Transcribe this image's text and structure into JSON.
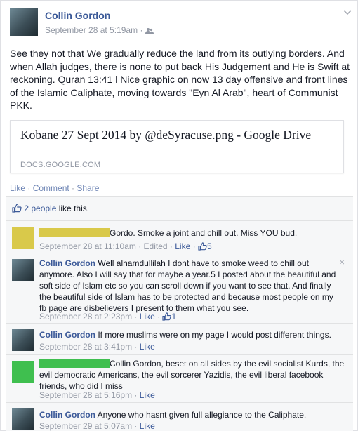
{
  "post": {
    "author": "Collin Gordon",
    "timestamp": "September 28 at 5:19am",
    "audience_icon": "friends-icon",
    "text": "See they not that We gradually reduce the land from its outlying borders. And when Allah judges, there is none to put back His Judgement and He is Swift at reckoning. Quran 13:41 l Nice graphic on now 13 day offensive and front lines of the Islamic Caliphate, moving towards \"Eyn Al Arab\", heart of Communist PKK.",
    "link": {
      "title": "Kobane 27 Sept 2014 by @deSyracuse.png - Google Drive",
      "domain": "DOCS.GOOGLE.COM"
    },
    "actions": {
      "like": "Like",
      "comment": "Comment",
      "share": "Share",
      "sep": " · "
    }
  },
  "likes": {
    "people": "2 people",
    "suffix": " like this."
  },
  "comments": [
    {
      "author_redacted": true,
      "text": "Gordo. Smoke a joint and chill out. Miss YOU bud.",
      "timestamp": "September 28 at 11:10am",
      "edited": "Edited",
      "like_label": "Like",
      "like_count": "5"
    },
    {
      "author": "Collin Gordon",
      "text": "Well alhamdullilah I dont have to smoke weed to chill out anymore. Also I will say that for maybe a year.5 I posted about the beautiful and soft side of Islam etc so you can scroll down if you want to see that. And finally the beautiful side of Islam has to be protected and because most people on my fb page are disbelievers I present to them what you see.",
      "timestamp": "September 28 at 2:23pm",
      "like_label": "Like",
      "like_count": "1"
    },
    {
      "author": "Collin Gordon",
      "text": "If more muslims were on my page I would post different things.",
      "timestamp": "September 28 at 3:41pm",
      "like_label": "Like"
    },
    {
      "author_redacted": true,
      "text": "Collin Gordon, beset on all sides by the evil socialist Kurds, the evil democratic Americans, the evil sorcerer Yazidis, the evil liberal facebook friends, who did I miss",
      "timestamp": "September 28 at 5:16pm",
      "like_label": "Like"
    },
    {
      "author": "Collin Gordon",
      "text": "Anyone who hasnt given full allegiance to the Caliphate.",
      "timestamp": "September 29 at 5:07am",
      "like_label": "Like"
    }
  ],
  "close_glyph": "×",
  "colors": {
    "link": "#3b5998",
    "meta": "#9197a3",
    "censor_yellow": "#d9c94a",
    "censor_green": "#3fbf4f"
  }
}
